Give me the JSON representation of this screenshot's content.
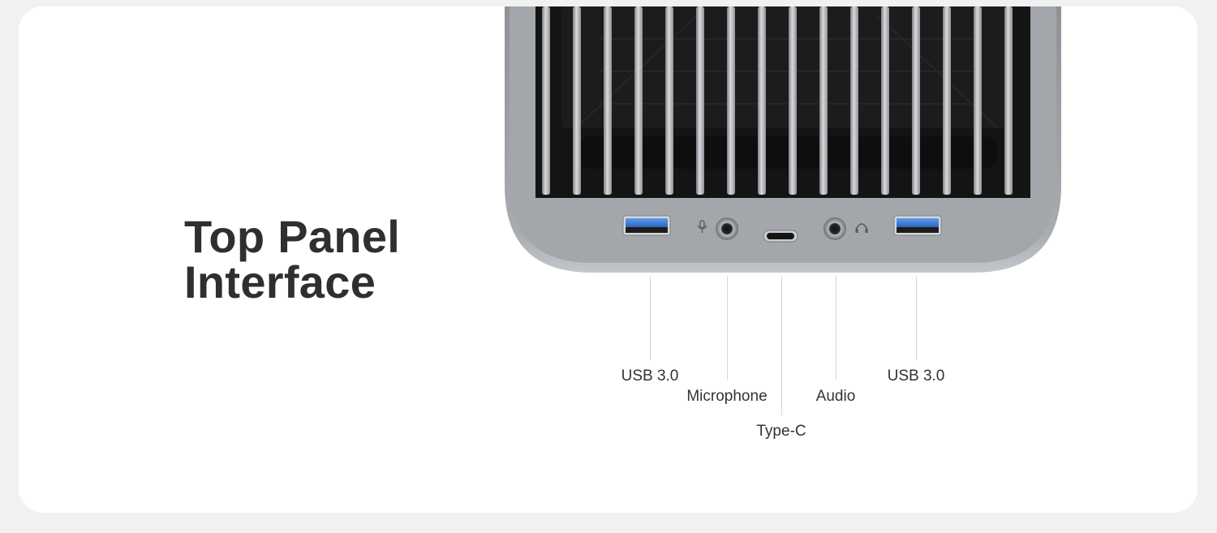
{
  "heading": {
    "line1": "Top Panel",
    "line2": "Interface"
  },
  "ports": [
    {
      "label": "USB 3.0",
      "icon": "usb-a-port"
    },
    {
      "label": "Microphone",
      "icon": "microphone-jack"
    },
    {
      "label": "Type-C",
      "icon": "usb-c-port"
    },
    {
      "label": "Audio",
      "icon": "headphone-jack"
    },
    {
      "label": "USB 3.0",
      "icon": "usb-a-port"
    }
  ],
  "colors": {
    "background": "#f1f1f1",
    "card": "#ffffff",
    "chassis": "#a9acb1",
    "usb_blue": "#3d7fd4",
    "text": "#2f2f2f"
  }
}
